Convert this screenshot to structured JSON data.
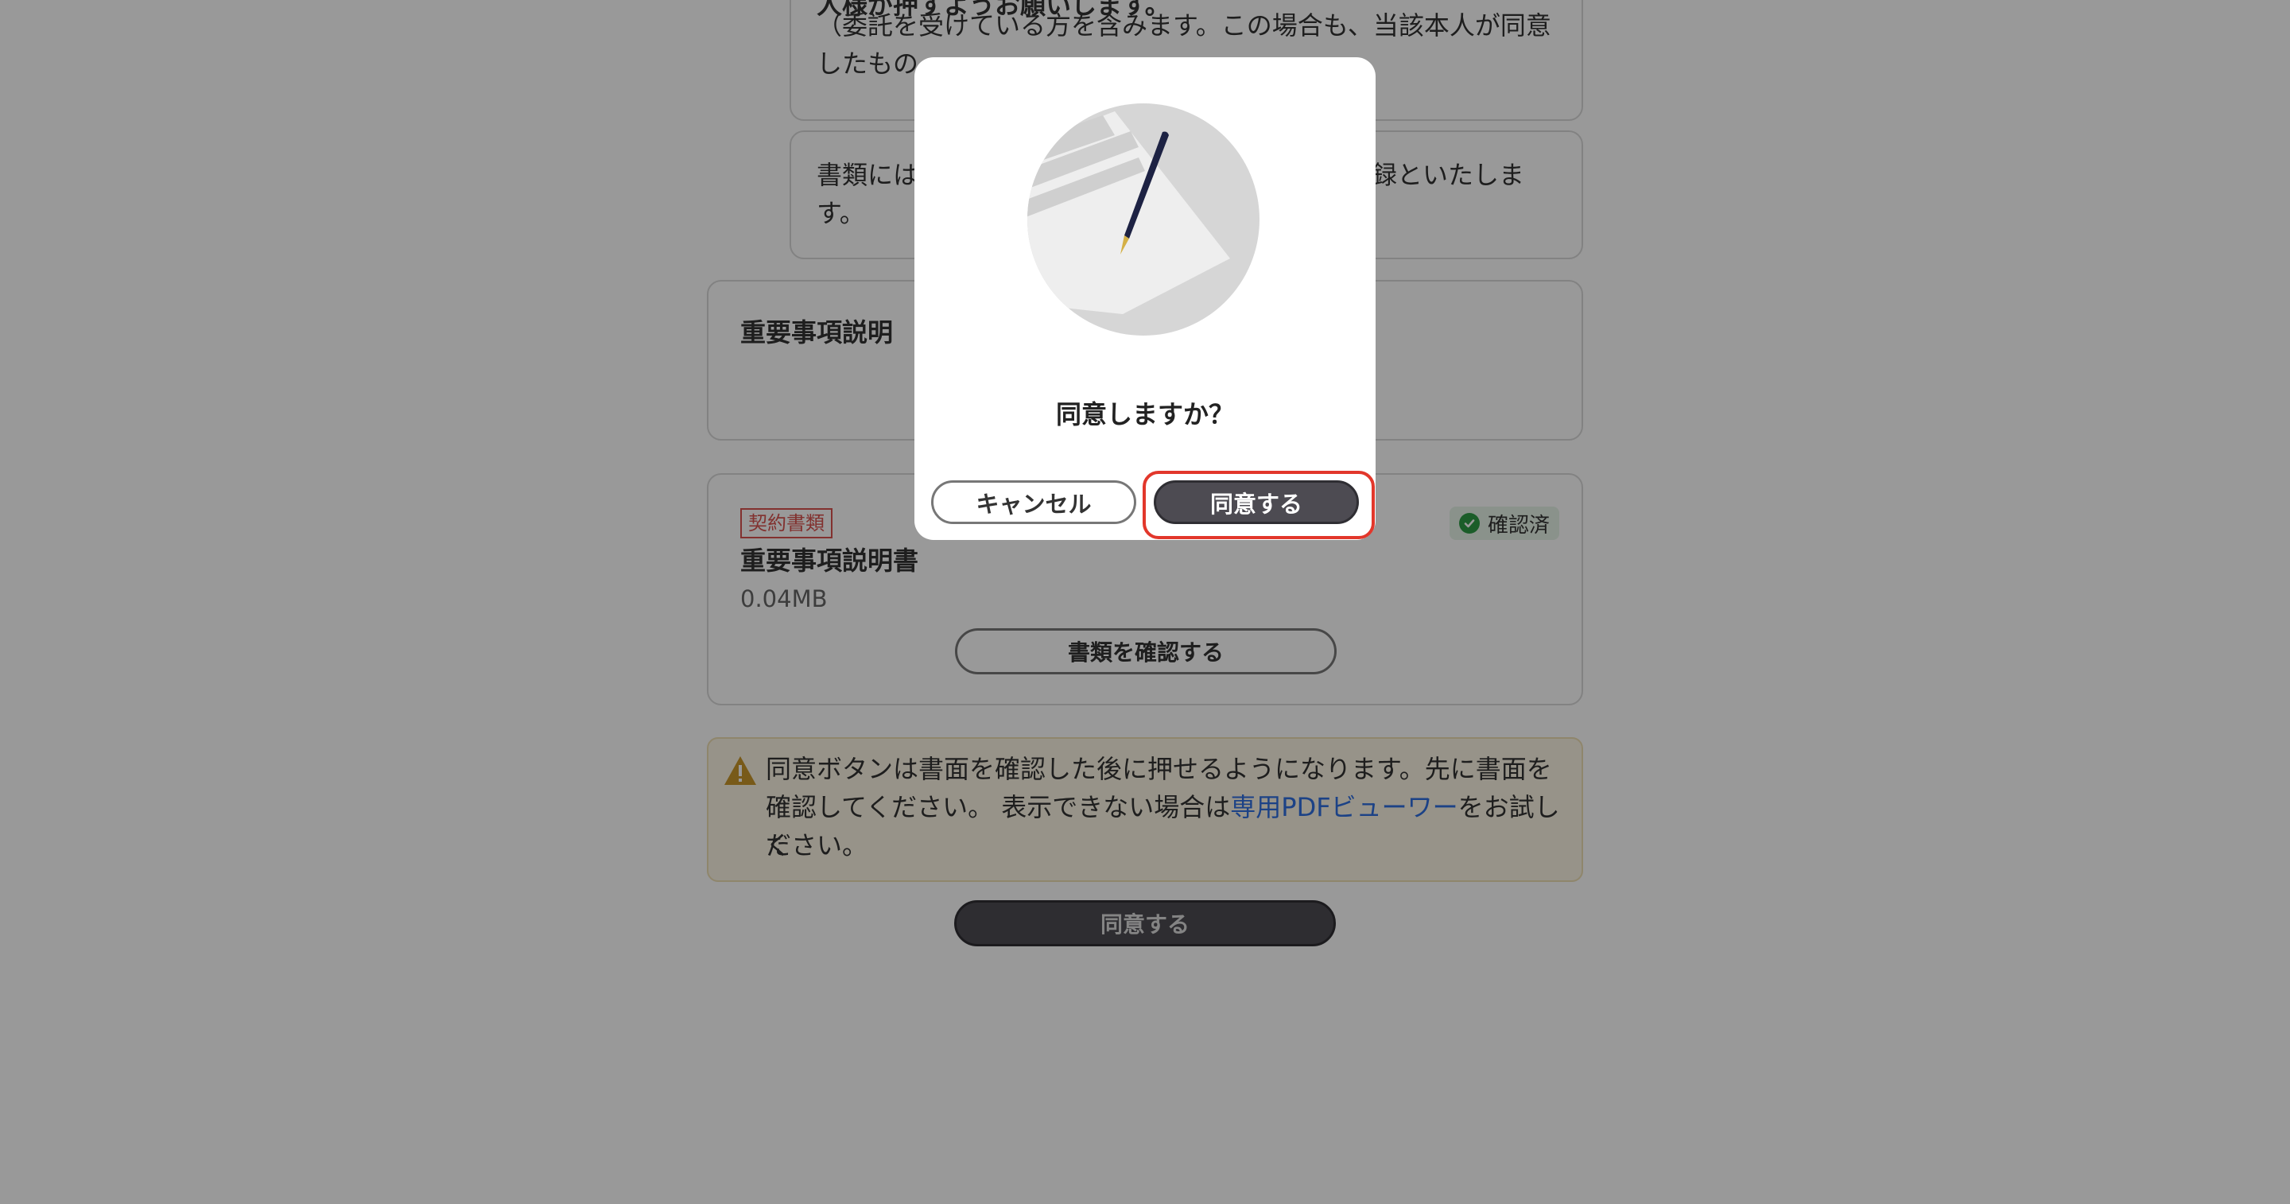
{
  "notice1": {
    "line0": "人様が押すようお願いします。",
    "line1": "（委託を受けている方を含みます。この場合も、当該本人が同意",
    "line2": "したもの"
  },
  "notice2": {
    "line1a": "書類には",
    "line1b": "録といたしま",
    "line2": "す。"
  },
  "section": {
    "title": "重要事項説明"
  },
  "document": {
    "tag": "契約書類",
    "name": "重要事項説明書",
    "size": "0.04MB",
    "status": "確認済",
    "view_button": "書類を確認する"
  },
  "warning": {
    "line1": "同意ボタンは書面を確認した後に押せるようになります。先に書面を",
    "line2_pre": "確認してください。 表示できない場合は",
    "line2_link": "専用PDFビューワー",
    "line2_post": "をお試しく",
    "line3": "ださい。"
  },
  "agree_button_bottom": "同意する",
  "modal": {
    "question": "同意しますか？",
    "cancel": "キャンセル",
    "agree": "同意する"
  },
  "colors": {
    "accent_dark": "#4d4b52",
    "highlight": "#e2372b",
    "tag_red": "#d9534f",
    "check_green": "#2e9b45",
    "link_blue": "#2f6fdf"
  }
}
